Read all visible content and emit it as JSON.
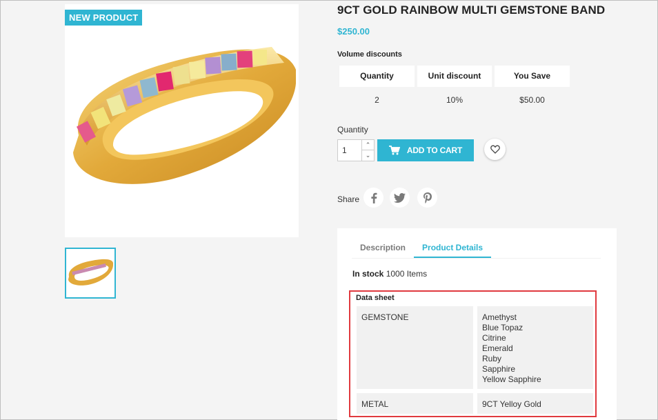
{
  "product": {
    "badge": "NEW PRODUCT",
    "title": "9CT GOLD RAINBOW MULTI GEMSTONE BAND",
    "price": "$250.00"
  },
  "volume_discounts": {
    "label": "Volume discounts",
    "headers": [
      "Quantity",
      "Unit discount",
      "You Save"
    ],
    "rows": [
      [
        "2",
        "10%",
        "$50.00"
      ]
    ]
  },
  "quantity": {
    "label": "Quantity",
    "value": "1"
  },
  "add_to_cart_label": "ADD TO CART",
  "share_label": "Share",
  "tabs": [
    "Description",
    "Product Details"
  ],
  "active_tab": "Product Details",
  "stock": {
    "label": "In stock",
    "value": "1000 Items"
  },
  "data_sheet": {
    "title": "Data sheet",
    "rows": [
      {
        "name": "GEMSTONE",
        "values": [
          "Amethyst",
          "Blue Topaz",
          "Citrine",
          "Emerald",
          "Ruby",
          "Sapphire",
          "Yellow Sapphire"
        ]
      },
      {
        "name": "METAL",
        "values": [
          "9CT Yelloy Gold"
        ]
      }
    ]
  },
  "icons": {
    "cart": "shopping-cart-icon",
    "wishlist": "heart-icon",
    "social": [
      "facebook-icon",
      "twitter-icon",
      "pinterest-icon"
    ]
  },
  "colors": {
    "accent": "#2fb5d2",
    "highlight_border": "#e0393e",
    "background": "#f4f4f4"
  }
}
